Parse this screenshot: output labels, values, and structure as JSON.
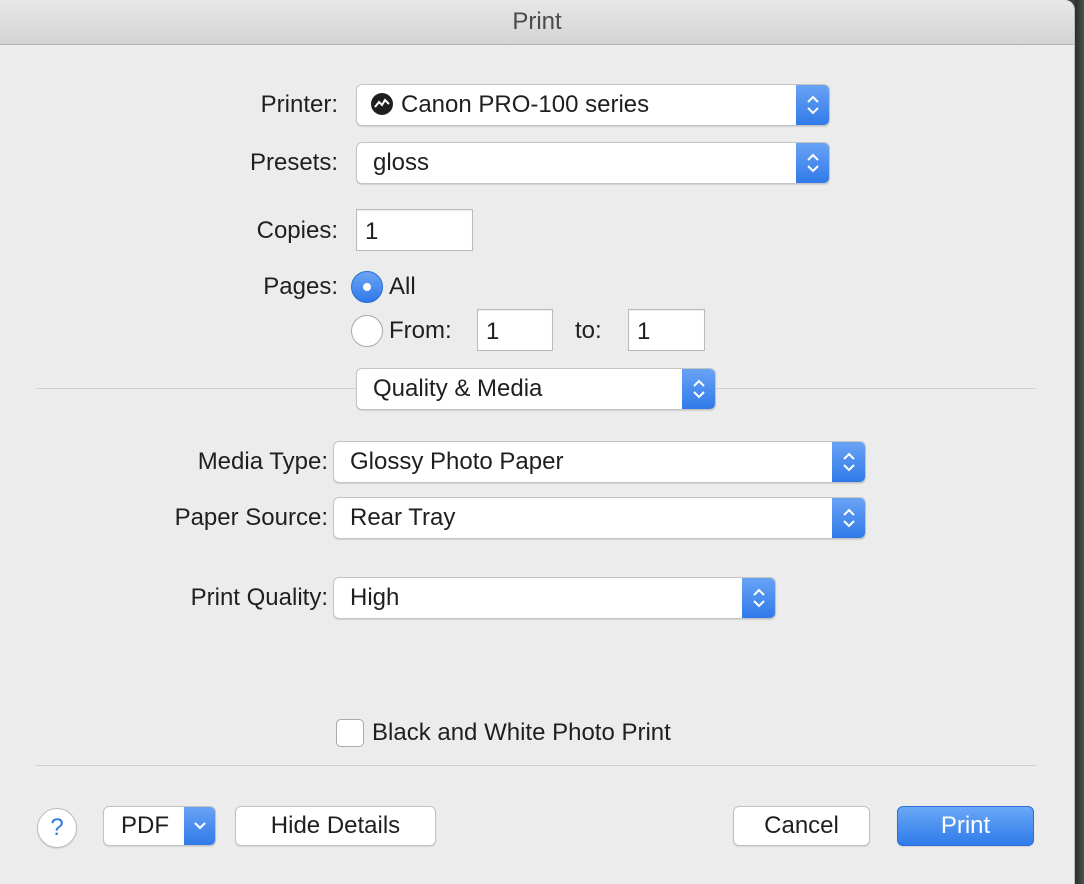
{
  "window": {
    "title": "Print"
  },
  "printer": {
    "label": "Printer:",
    "value": "Canon PRO-100 series",
    "icon": "printer-share-icon"
  },
  "presets": {
    "label": "Presets:",
    "value": "gloss"
  },
  "copies": {
    "label": "Copies:",
    "value": "1"
  },
  "pages": {
    "label": "Pages:",
    "all_label": "All",
    "from_label": "From:",
    "to_label": "to:",
    "from_value": "1",
    "to_value": "1",
    "selected": "All"
  },
  "panel_select": {
    "value": "Quality & Media"
  },
  "media_type": {
    "label": "Media Type:",
    "value": "Glossy Photo Paper"
  },
  "paper_source": {
    "label": "Paper Source:",
    "value": "Rear Tray"
  },
  "print_quality": {
    "label": "Print Quality:",
    "value": "High"
  },
  "bw_photo": {
    "label": "Black and White Photo Print",
    "checked": false
  },
  "footer": {
    "help_label": "?",
    "pdf_label": "PDF",
    "hide_details_label": "Hide Details",
    "cancel_label": "Cancel",
    "print_label": "Print"
  },
  "colors": {
    "accent": "#2f79e8",
    "background": "#ececec"
  }
}
